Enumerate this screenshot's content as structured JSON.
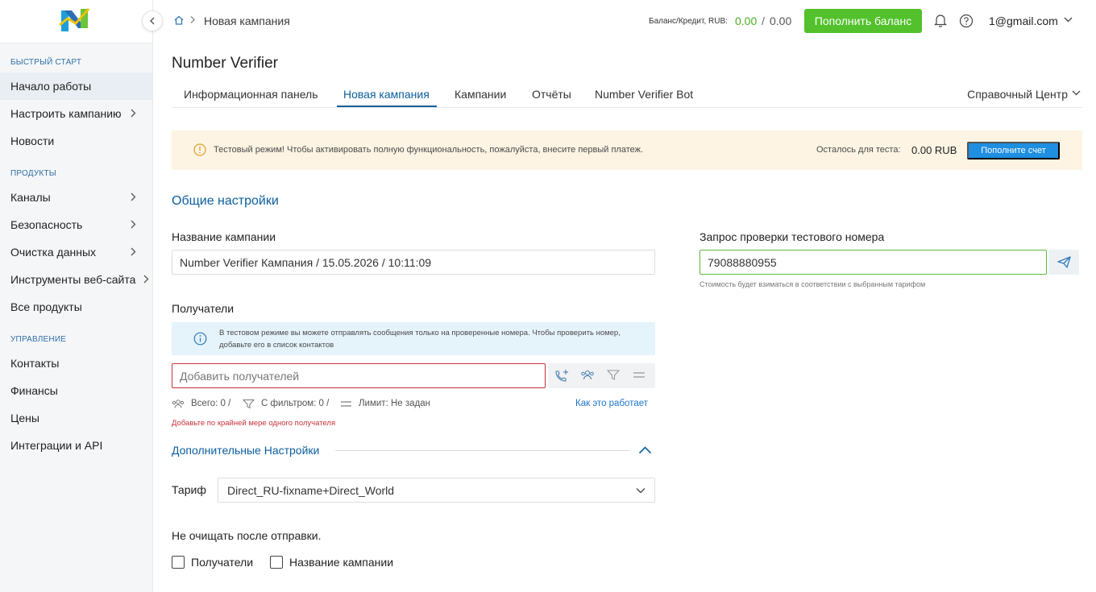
{
  "sidebar": {
    "sections": [
      {
        "title": "Быстрый старт",
        "items": [
          {
            "label": "Начало работы"
          },
          {
            "label": "Настроить кампанию"
          },
          {
            "label": "Новости"
          }
        ]
      },
      {
        "title": "Продукты",
        "items": [
          {
            "label": "Каналы"
          },
          {
            "label": "Безопасность"
          },
          {
            "label": "Очистка данных"
          },
          {
            "label": "Инструменты веб-сайта"
          },
          {
            "label": "Все продукты"
          }
        ]
      },
      {
        "title": "Управление",
        "items": [
          {
            "label": "Контакты"
          },
          {
            "label": "Финансы"
          },
          {
            "label": "Цены"
          },
          {
            "label": "Интеграции и API"
          }
        ]
      }
    ]
  },
  "header": {
    "breadcrumb_current": "Новая кампания",
    "balance_label": "Баланс/Кредит, RUB:",
    "balance_value": "0.00",
    "balance_separator": "/",
    "credit_value": "0.00",
    "topup_label": "Пополнить баланс",
    "user_email": "1@gmail.com"
  },
  "page": {
    "title": "Number Verifier",
    "tabs": [
      {
        "label": "Информационная панель"
      },
      {
        "label": "Новая кампания"
      },
      {
        "label": "Кампании"
      },
      {
        "label": "Отчёты"
      },
      {
        "label": "Number Verifier Bot"
      }
    ],
    "help_center": "Справочный Центр"
  },
  "warning": {
    "text": "Тестовый режим! Чтобы активировать полную функциональность, пожалуйста, внесите первый платеж.",
    "remain_label": "Осталось для теста:",
    "remain_value": "0.00 RUB",
    "pay_label": "Пополните счет"
  },
  "form": {
    "section_title": "Общие настройки",
    "campaign_name_label": "Название кампании",
    "campaign_name_value": "Number Verifier Кампания / 15.05.2026 / 10:11:09",
    "test_number_label": "Запрос проверки тестового номера",
    "test_number_value": "79088880955",
    "test_number_hint": "Стоимость будет взиматься в соответствии с выбранным тарифом",
    "recipients_label": "Получатели",
    "recipients_info": "В тестовом режиме вы можете отправлять сообщения только на проверенные номера. Чтобы проверить номер, добавьте его в список контактов",
    "recipients_placeholder": "Добавить получателей",
    "stats_total": "Всего: 0 /",
    "stats_filtered": "С фильтром: 0 /",
    "stats_limit": "Лимит: Не задан",
    "how_it_works": "Как это работает",
    "recipients_error": "Добавьте по крайней мере одного получателя",
    "advanced_title": "Дополнительные Настройки",
    "tariff_label": "Тариф",
    "tariff_value": "Direct_RU-fixname+Direct_World",
    "no_clear_label": "Не очищать после отправки.",
    "cb_recipients": "Получатели",
    "cb_campaign_name": "Название кампании"
  },
  "colors": {
    "accent": "#0b5e9e",
    "success": "#53c12c",
    "error": "#c7323b",
    "link": "#1e75c9"
  }
}
